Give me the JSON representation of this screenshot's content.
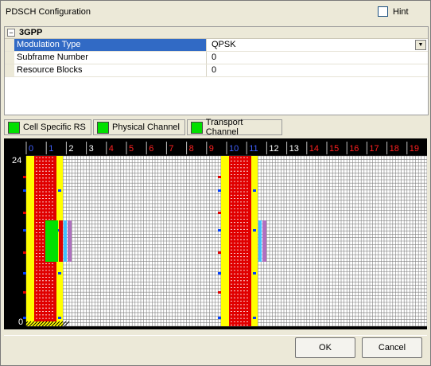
{
  "window": {
    "title": "PDSCH Configuration",
    "hint_label": "Hint"
  },
  "property_grid": {
    "category": "3GPP",
    "rows": [
      {
        "name": "Modulation Type",
        "value": "QPSK"
      },
      {
        "name": "Subframe Number",
        "value": "0"
      },
      {
        "name": "Resource Blocks",
        "value": "0"
      }
    ]
  },
  "legend": [
    {
      "label": "Cell Specific RS",
      "color": "#00e000"
    },
    {
      "label": "Physical Channel",
      "color": "#00e000"
    },
    {
      "label": "Transport Channel",
      "color": "#00e000"
    }
  ],
  "resource_grid": {
    "slot_labels": [
      "0",
      "1",
      "2",
      "3",
      "4",
      "5",
      "6",
      "7",
      "8",
      "9",
      "10",
      "11",
      "12",
      "13",
      "14",
      "15",
      "16",
      "17",
      "18",
      "19"
    ],
    "y_top_label": "24",
    "y_bottom_label": "0",
    "colors": {
      "control": "#ffff00",
      "pdcch": "#e00000",
      "sync": "#00e000",
      "cell_rs": "#0040ff",
      "grid_line": "#808080",
      "label_blue": "#4060ff",
      "label_red": "#ff2020",
      "label_white": "#ffffff"
    }
  },
  "buttons": {
    "ok": "OK",
    "cancel": "Cancel"
  }
}
